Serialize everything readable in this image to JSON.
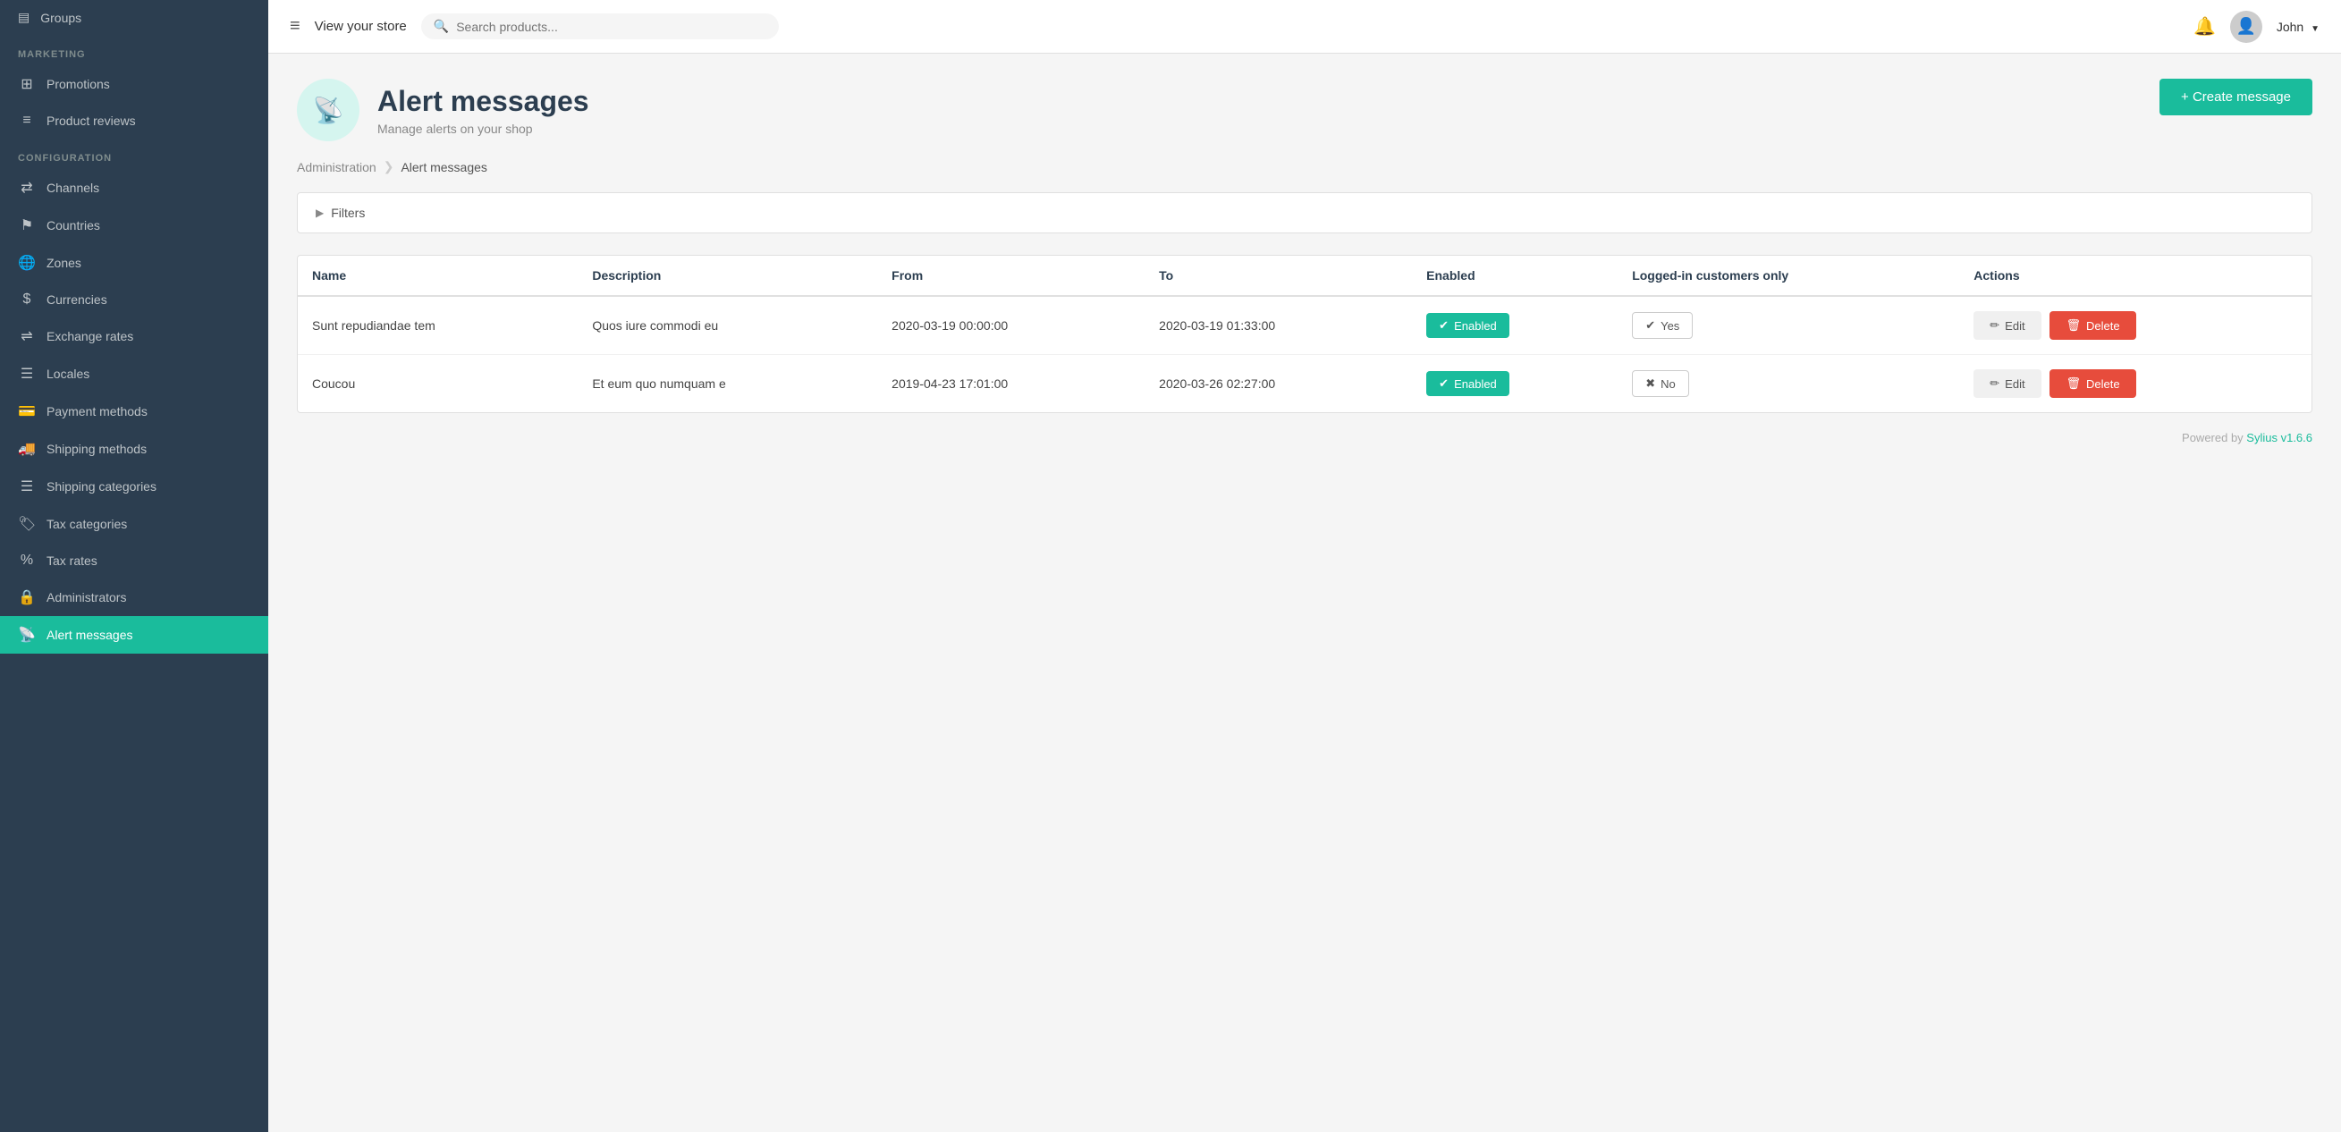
{
  "sidebar": {
    "groups_label": "Groups",
    "marketing_label": "MARKETING",
    "configuration_label": "CONFIGURATION",
    "items_top": [
      {
        "id": "groups",
        "label": "Groups",
        "icon": "▤"
      }
    ],
    "items_marketing": [
      {
        "id": "promotions",
        "label": "Promotions",
        "icon": "⊞"
      },
      {
        "id": "product-reviews",
        "label": "Product reviews",
        "icon": "≡"
      }
    ],
    "items_configuration": [
      {
        "id": "channels",
        "label": "Channels",
        "icon": "⇄"
      },
      {
        "id": "countries",
        "label": "Countries",
        "icon": "⚑"
      },
      {
        "id": "zones",
        "label": "Zones",
        "icon": "🌐"
      },
      {
        "id": "currencies",
        "label": "Currencies",
        "icon": "$"
      },
      {
        "id": "exchange-rates",
        "label": "Exchange rates",
        "icon": "⇌"
      },
      {
        "id": "locales",
        "label": "Locales",
        "icon": "☰"
      },
      {
        "id": "payment-methods",
        "label": "Payment methods",
        "icon": "💳"
      },
      {
        "id": "shipping-methods",
        "label": "Shipping methods",
        "icon": "🚚"
      },
      {
        "id": "shipping-categories",
        "label": "Shipping categories",
        "icon": "☰"
      },
      {
        "id": "tax-categories",
        "label": "Tax categories",
        "icon": "🏷"
      },
      {
        "id": "tax-rates",
        "label": "Tax rates",
        "icon": "%"
      },
      {
        "id": "administrators",
        "label": "Administrators",
        "icon": "🔒"
      },
      {
        "id": "alert-messages",
        "label": "Alert messages",
        "icon": "📡",
        "active": true
      }
    ]
  },
  "topbar": {
    "hamburger_icon": "≡",
    "store_link": "View your store",
    "search_placeholder": "Search products...",
    "search_icon": "🔍",
    "bell_icon": "🔔",
    "username": "John",
    "dropdown_icon": "▼"
  },
  "page": {
    "icon": "📡",
    "title": "Alert messages",
    "subtitle": "Manage alerts on your shop",
    "create_btn_label": "+ Create message"
  },
  "breadcrumb": {
    "admin_label": "Administration",
    "separator": "❯",
    "current": "Alert messages"
  },
  "filters": {
    "arrow": "▶",
    "label": "Filters"
  },
  "table": {
    "columns": [
      "Name",
      "Description",
      "From",
      "To",
      "Enabled",
      "Logged-in customers only",
      "Actions"
    ],
    "rows": [
      {
        "name": "Sunt repudiandae tem",
        "description": "Quos iure commodi eu",
        "from": "2020-03-19 00:00:00",
        "to": "2020-03-19 01:33:00",
        "enabled": true,
        "enabled_label": "Enabled",
        "logged_in": true,
        "logged_in_label": "Yes",
        "edit_label": "Edit",
        "delete_label": "Delete"
      },
      {
        "name": "Coucou",
        "description": "Et eum quo numquam e",
        "from": "2019-04-23 17:01:00",
        "to": "2020-03-26 02:27:00",
        "enabled": true,
        "enabled_label": "Enabled",
        "logged_in": false,
        "logged_in_label": "No",
        "edit_label": "Edit",
        "delete_label": "Delete"
      }
    ]
  },
  "footer": {
    "powered_by": "Powered by ",
    "sylius_link": "Sylius v1.6.6"
  }
}
